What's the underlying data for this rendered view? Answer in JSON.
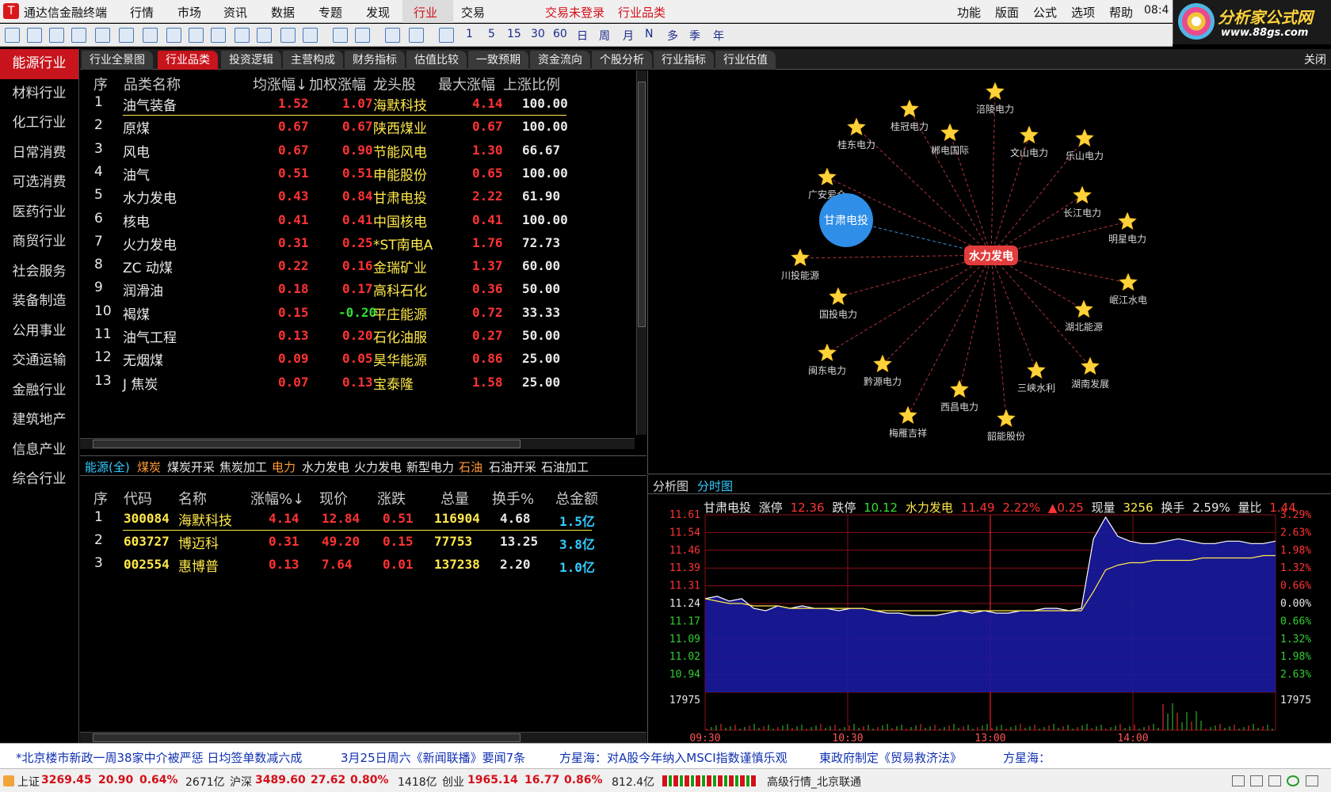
{
  "app": {
    "title": "通达信金融终端",
    "login_status": "交易未登录",
    "current_view": "行业品类",
    "clock": "08:4"
  },
  "menu": [
    "行情",
    "市场",
    "资讯",
    "数据",
    "专题",
    "发现",
    "行业",
    "交易"
  ],
  "right_menu": [
    "功能",
    "版面",
    "公式",
    "选项",
    "帮助"
  ],
  "brand": {
    "name": "分析家公式网",
    "url": "www.88gs.com"
  },
  "toolbar_periods": [
    "1",
    "5",
    "15",
    "30",
    "60",
    "日",
    "周",
    "月",
    "N",
    "多",
    "季",
    "年"
  ],
  "leftnav": [
    "能源行业",
    "材料行业",
    "化工行业",
    "日常消费",
    "可选消费",
    "医药行业",
    "商贸行业",
    "社会服务",
    "装备制造",
    "公用事业",
    "交通运输",
    "金融行业",
    "建筑地产",
    "信息产业",
    "综合行业"
  ],
  "tabs": [
    "行业全景图",
    "行业品类",
    "投资逻辑",
    "主营构成",
    "财务指标",
    "估值比较",
    "一致预期",
    "资金流向",
    "个股分析",
    "行业指标",
    "行业估值"
  ],
  "close_label": "关闭",
  "upper_table": {
    "headers": [
      "序",
      "品类名称",
      "均涨幅↓",
      "加权涨幅",
      "龙头股",
      "最大涨幅",
      "上涨比例"
    ],
    "rows": [
      {
        "no": "1",
        "name": "油气装备",
        "avg": "1.52",
        "wtd": "1.07",
        "leader": "海默科技",
        "max": "4.14",
        "ratio": "100.00"
      },
      {
        "no": "2",
        "name": "原煤",
        "avg": "0.67",
        "wtd": "0.67",
        "leader": "陕西煤业",
        "max": "0.67",
        "ratio": "100.00"
      },
      {
        "no": "3",
        "name": "风电",
        "avg": "0.67",
        "wtd": "0.90",
        "leader": "节能风电",
        "max": "1.30",
        "ratio": "66.67"
      },
      {
        "no": "4",
        "name": "油气",
        "avg": "0.51",
        "wtd": "0.51",
        "leader": "申能股份",
        "max": "0.65",
        "ratio": "100.00"
      },
      {
        "no": "5",
        "name": "水力发电",
        "avg": "0.43",
        "wtd": "0.84",
        "leader": "甘肃电投",
        "max": "2.22",
        "ratio": "61.90"
      },
      {
        "no": "6",
        "name": "核电",
        "avg": "0.41",
        "wtd": "0.41",
        "leader": "中国核电",
        "max": "0.41",
        "ratio": "100.00"
      },
      {
        "no": "7",
        "name": "火力发电",
        "avg": "0.31",
        "wtd": "0.25",
        "leader": "*ST南电A",
        "max": "1.76",
        "ratio": "72.73"
      },
      {
        "no": "8",
        "name": "ZC 动煤",
        "avg": "0.22",
        "wtd": "0.16",
        "leader": "金瑞矿业",
        "max": "1.37",
        "ratio": "60.00"
      },
      {
        "no": "9",
        "name": "润滑油",
        "avg": "0.18",
        "wtd": "0.17",
        "leader": "高科石化",
        "max": "0.36",
        "ratio": "50.00"
      },
      {
        "no": "10",
        "name": "褐煤",
        "avg": "0.15",
        "wtd": "-0.20",
        "leader": "平庄能源",
        "max": "0.72",
        "ratio": "33.33"
      },
      {
        "no": "11",
        "name": "油气工程",
        "avg": "0.13",
        "wtd": "0.20",
        "leader": "石化油服",
        "max": "0.27",
        "ratio": "50.00"
      },
      {
        "no": "12",
        "name": "无烟煤",
        "avg": "0.09",
        "wtd": "0.05",
        "leader": "昊华能源",
        "max": "0.86",
        "ratio": "25.00"
      },
      {
        "no": "13",
        "name": "J 焦炭",
        "avg": "0.07",
        "wtd": "0.13",
        "leader": "宝泰隆",
        "max": "1.58",
        "ratio": "25.00"
      }
    ]
  },
  "subtabs": [
    "能源(全)",
    "煤炭",
    "煤炭开采",
    "焦炭加工",
    "电力",
    "水力发电",
    "火力发电",
    "新型电力",
    "石油",
    "石油开采",
    "石油加工"
  ],
  "lower_table": {
    "headers": [
      "序",
      "代码",
      "名称",
      "涨幅%↓",
      "现价",
      "涨跌",
      "总量",
      "换手%",
      "总金额"
    ],
    "rows": [
      {
        "no": "1",
        "code": "300084",
        "name": "海默科技",
        "pct": "4.14",
        "price": "12.84",
        "chg": "0.51",
        "vol": "116904",
        "turn": "4.68",
        "amt": "1.5亿"
      },
      {
        "no": "2",
        "code": "603727",
        "name": "博迈科",
        "pct": "0.31",
        "price": "49.20",
        "chg": "0.15",
        "vol": "77753",
        "turn": "13.25",
        "amt": "3.8亿"
      },
      {
        "no": "3",
        "code": "002554",
        "name": "惠博普",
        "pct": "0.13",
        "price": "7.64",
        "chg": "0.01",
        "vol": "137238",
        "turn": "2.20",
        "amt": "1.0亿"
      }
    ]
  },
  "graph": {
    "center": "水力发电",
    "highlight": "甘肃电投",
    "nodes": [
      "涪陵电力",
      "桂冠电力",
      "郴电国际",
      "桂东电力",
      "文山电力",
      "乐山电力",
      "广安爱众",
      "长江电力",
      "明星电力",
      "川投能源",
      "岷江水电",
      "国投电力",
      "湖北能源",
      "闽东电力",
      "黔源电力",
      "三峡水利",
      "湖南发展",
      "西昌电力",
      "梅雁吉祥",
      "韶能股份"
    ]
  },
  "minute_tabs": [
    "分析图",
    "分时图"
  ],
  "minute_info": {
    "name": "甘肃电投",
    "limit_up_label": "涨停",
    "limit_up": "12.36",
    "limit_down_label": "跌停",
    "limit_down": "10.12",
    "sector": "水力发电",
    "sector_price": "11.49",
    "sector_pct": "2.22%",
    "sector_chg": "▲0.25",
    "vol_label": "现量",
    "vol": "3256",
    "turn_label": "换手",
    "turn": "2.59%",
    "ratio_label": "量比",
    "ratio": "1.44"
  },
  "chart_data": {
    "type": "line",
    "title": "甘肃电投 分时图",
    "x_ticks": [
      "09:30",
      "10:30",
      "13:00",
      "14:00"
    ],
    "y_price_ticks": [
      "11.61",
      "11.54",
      "11.46",
      "11.39",
      "11.31",
      "11.24",
      "11.17",
      "11.09",
      "11.02",
      "10.94"
    ],
    "y_pct_ticks": [
      "3.29%",
      "2.63%",
      "1.98%",
      "1.32%",
      "0.66%",
      "0.00%",
      "0.66%",
      "1.32%",
      "1.98%",
      "2.63%"
    ],
    "ylim": [
      10.87,
      11.61
    ],
    "vol_tick": "17975",
    "price_series": [
      11.26,
      11.27,
      11.25,
      11.26,
      11.22,
      11.21,
      11.23,
      11.22,
      11.23,
      11.22,
      11.22,
      11.21,
      11.22,
      11.22,
      11.21,
      11.2,
      11.2,
      11.19,
      11.19,
      11.19,
      11.2,
      11.21,
      11.2,
      11.21,
      11.2,
      11.2,
      11.21,
      11.21,
      11.22,
      11.22,
      11.21,
      11.22,
      11.51,
      11.6,
      11.52,
      11.5,
      11.49,
      11.49,
      11.5,
      11.51,
      11.5,
      11.49,
      11.49,
      11.5,
      11.5,
      11.49,
      11.49,
      11.5
    ],
    "avg_series": [
      11.26,
      11.25,
      11.24,
      11.24,
      11.23,
      11.23,
      11.23,
      11.22,
      11.22,
      11.22,
      11.22,
      11.22,
      11.22,
      11.22,
      11.21,
      11.21,
      11.21,
      11.21,
      11.21,
      11.21,
      11.21,
      11.21,
      11.21,
      11.21,
      11.21,
      11.21,
      11.21,
      11.21,
      11.21,
      11.21,
      11.21,
      11.21,
      11.29,
      11.38,
      11.4,
      11.41,
      11.41,
      11.42,
      11.42,
      11.42,
      11.42,
      11.43,
      11.43,
      11.43,
      11.43,
      11.43,
      11.44,
      11.44
    ]
  },
  "ticker": [
    "*北京楼市新政一周38家中介被严惩 日均签单数减六成",
    "3月25日周六《新闻联播》要闻7条",
    "方星海：对A股今年纳入MSCI指数谨慎乐观",
    "東政府制定《贸易救济法》",
    "方星海："
  ],
  "status": {
    "sh_label": "上证",
    "sh": "3269.45",
    "sh_chg": "20.90",
    "sh_pct": "0.64%",
    "sh_amt": "2671亿",
    "sz_label": "沪深",
    "sz": "3489.60",
    "sz_chg": "27.62",
    "sz_pct": "0.80%",
    "sz_amt": "1418亿",
    "cy_label": "创业",
    "cy": "1965.14",
    "cy_chg": "16.77",
    "cy_pct": "0.86%",
    "cy_amt": "812.4亿",
    "server": "高级行情_北京联通"
  }
}
